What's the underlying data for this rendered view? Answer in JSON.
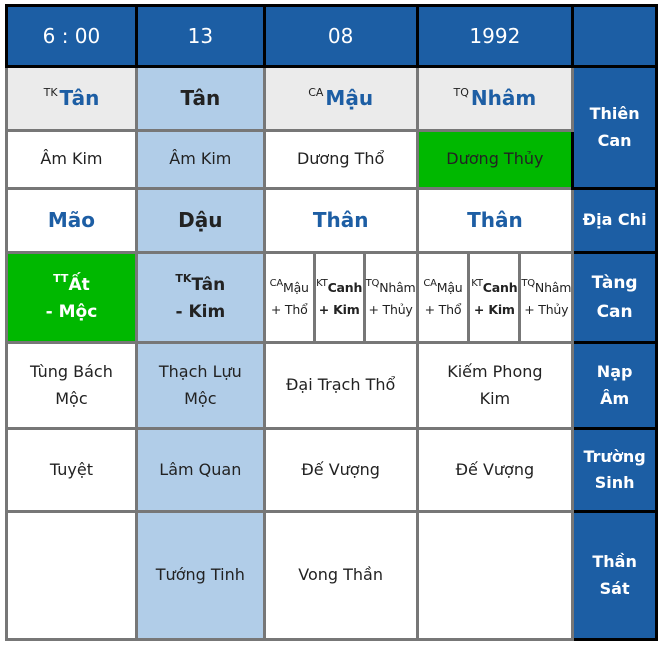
{
  "colors": {
    "header_bg": "#1c5ea4",
    "highlight_column_bg": "#b1cde8",
    "green_cell_bg": "#00b800",
    "grey_row_bg": "#ebebeb",
    "stem_text": "#1d5ea4",
    "grid_line": "#777777"
  },
  "header": {
    "hour": "6 : 00",
    "day": "13",
    "month": "08",
    "year": "1992",
    "corner": ""
  },
  "row_labels": {
    "thien_can": [
      "Thiên",
      "Can"
    ],
    "dia_chi": "Địa Chi",
    "tang_can": [
      "Tàng",
      "Can"
    ],
    "nap_am": [
      "Nạp",
      "Âm"
    ],
    "truong_sinh": [
      "Trường",
      "Sinh"
    ],
    "than_sat": [
      "Thần",
      "Sát"
    ]
  },
  "thien_can": [
    {
      "prefix": "TK",
      "name": "Tân"
    },
    {
      "prefix": "",
      "name": "Tân"
    },
    {
      "prefix": "CA",
      "name": "Mậu"
    },
    {
      "prefix": "TQ",
      "name": "Nhâm"
    }
  ],
  "thien_can_element": [
    "Âm Kim",
    "Âm Kim",
    "Dương Thổ",
    "Dương Thủy"
  ],
  "dia_chi": [
    "Mão",
    "Dậu",
    "Thân",
    "Thân"
  ],
  "tang_can": {
    "hour": {
      "prefix": "TT",
      "name": "Ất",
      "element": "- Mộc"
    },
    "day": {
      "prefix": "TK",
      "name": "Tân",
      "element": "- Kim"
    },
    "month": [
      {
        "prefix": "CA",
        "name": "Mậu",
        "element": "+ Thổ"
      },
      {
        "prefix": "KT",
        "name": "Canh",
        "element": "+ Kim"
      },
      {
        "prefix": "TQ",
        "name": "Nhâm",
        "element": "+ Thủy"
      }
    ],
    "year": [
      {
        "prefix": "CA",
        "name": "Mậu",
        "element": "+ Thổ"
      },
      {
        "prefix": "KT",
        "name": "Canh",
        "element": "+ Kim"
      },
      {
        "prefix": "TQ",
        "name": "Nhâm",
        "element": "+ Thủy"
      }
    ]
  },
  "nap_am": [
    [
      "Tùng Bách",
      "Mộc"
    ],
    [
      "Thạch Lựu",
      "Mộc"
    ],
    [
      "Đại Trạch Thổ"
    ],
    [
      "Kiếm Phong",
      "Kim"
    ]
  ],
  "truong_sinh": [
    "Tuyệt",
    "Lâm Quan",
    "Đế Vượng",
    "Đế Vượng"
  ],
  "than_sat": [
    "",
    "Tướng Tinh",
    "Vong Thần",
    ""
  ]
}
